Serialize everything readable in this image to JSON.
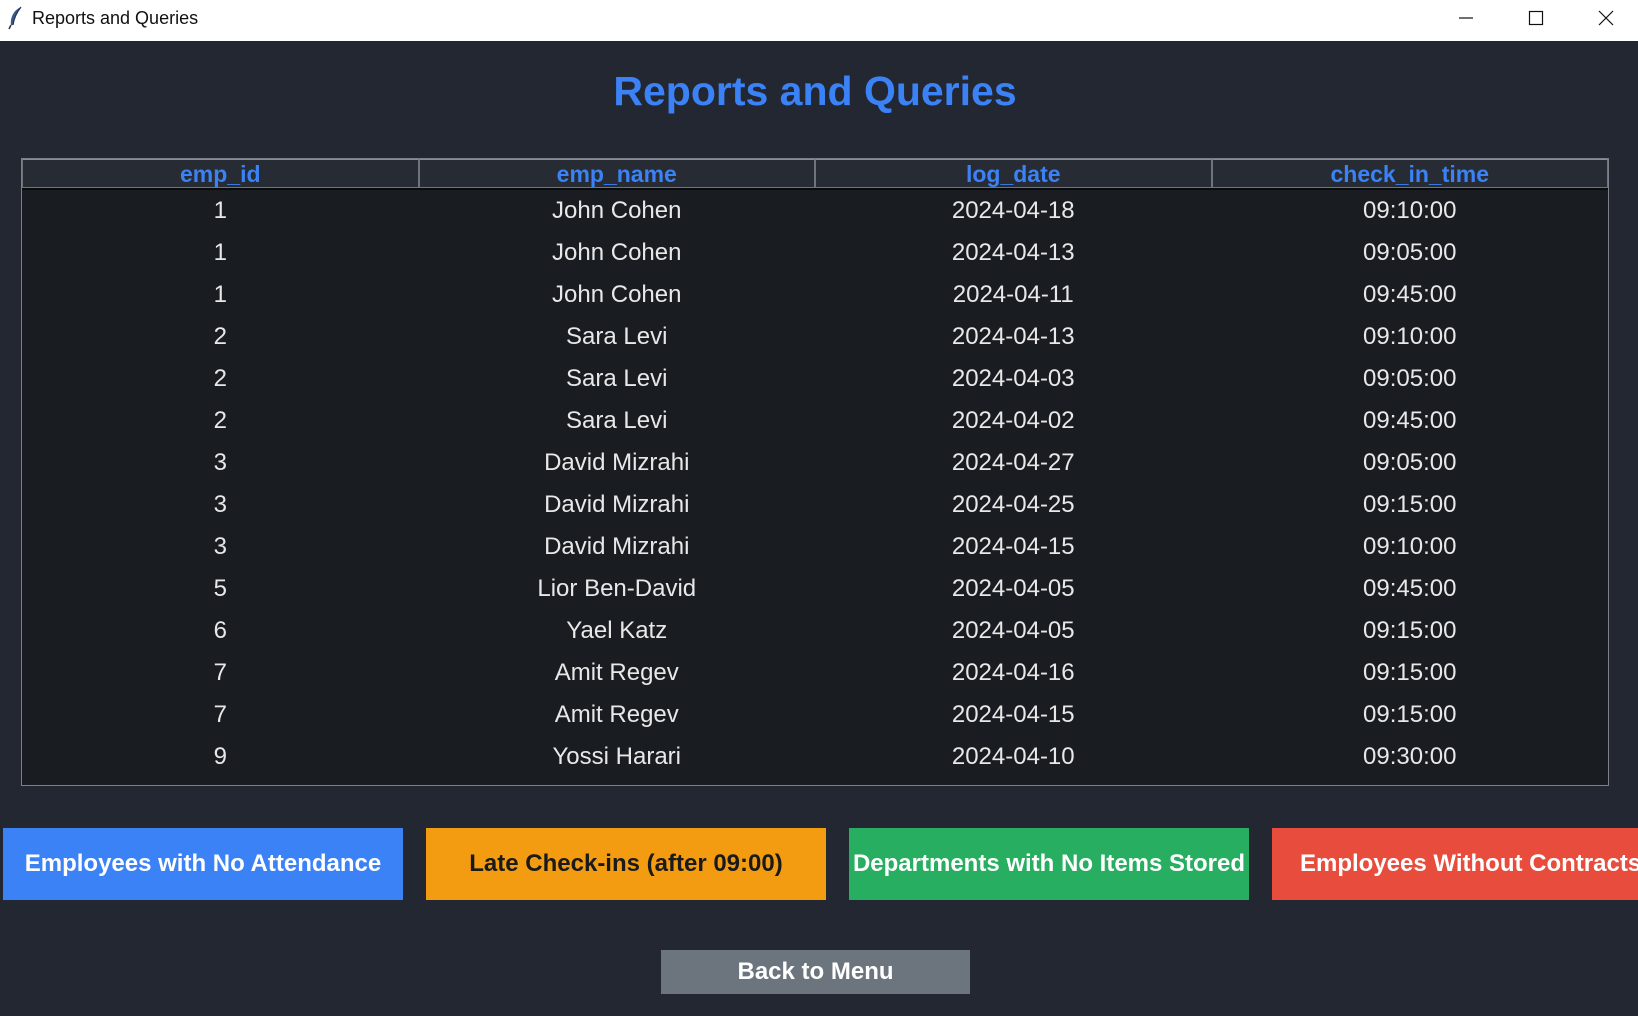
{
  "window": {
    "title": "Reports and Queries",
    "controls": {
      "minimize_icon": "minimize-icon",
      "maximize_icon": "maximize-icon",
      "close_icon": "close-icon"
    }
  },
  "page": {
    "title": "Reports and Queries"
  },
  "table": {
    "columns": [
      "emp_id",
      "emp_name",
      "log_date",
      "check_in_time"
    ],
    "rows": [
      [
        "1",
        "John Cohen",
        "2024-04-18",
        "09:10:00"
      ],
      [
        "1",
        "John Cohen",
        "2024-04-13",
        "09:05:00"
      ],
      [
        "1",
        "John Cohen",
        "2024-04-11",
        "09:45:00"
      ],
      [
        "2",
        "Sara Levi",
        "2024-04-13",
        "09:10:00"
      ],
      [
        "2",
        "Sara Levi",
        "2024-04-03",
        "09:05:00"
      ],
      [
        "2",
        "Sara Levi",
        "2024-04-02",
        "09:45:00"
      ],
      [
        "3",
        "David Mizrahi",
        "2024-04-27",
        "09:05:00"
      ],
      [
        "3",
        "David Mizrahi",
        "2024-04-25",
        "09:15:00"
      ],
      [
        "3",
        "David Mizrahi",
        "2024-04-15",
        "09:10:00"
      ],
      [
        "5",
        "Lior Ben-David",
        "2024-04-05",
        "09:45:00"
      ],
      [
        "6",
        "Yael Katz",
        "2024-04-05",
        "09:15:00"
      ],
      [
        "7",
        "Amit Regev",
        "2024-04-16",
        "09:15:00"
      ],
      [
        "7",
        "Amit Regev",
        "2024-04-15",
        "09:15:00"
      ],
      [
        "9",
        "Yossi Harari",
        "2024-04-10",
        "09:30:00"
      ]
    ]
  },
  "actions": {
    "no_attendance": "Employees with No Attendance",
    "late_checkins": "Late Check-ins (after 09:00)",
    "no_items_departments": "Departments with No Items Stored",
    "no_contracts": "Employees Without Contracts",
    "back": "Back to Menu"
  },
  "colors": {
    "background": "#222731",
    "table_background": "#191c21",
    "accent_blue": "#3b82f6",
    "orange": "#f39c12",
    "green": "#27ae60",
    "red": "#e74c3c",
    "gray": "#6c757d"
  }
}
